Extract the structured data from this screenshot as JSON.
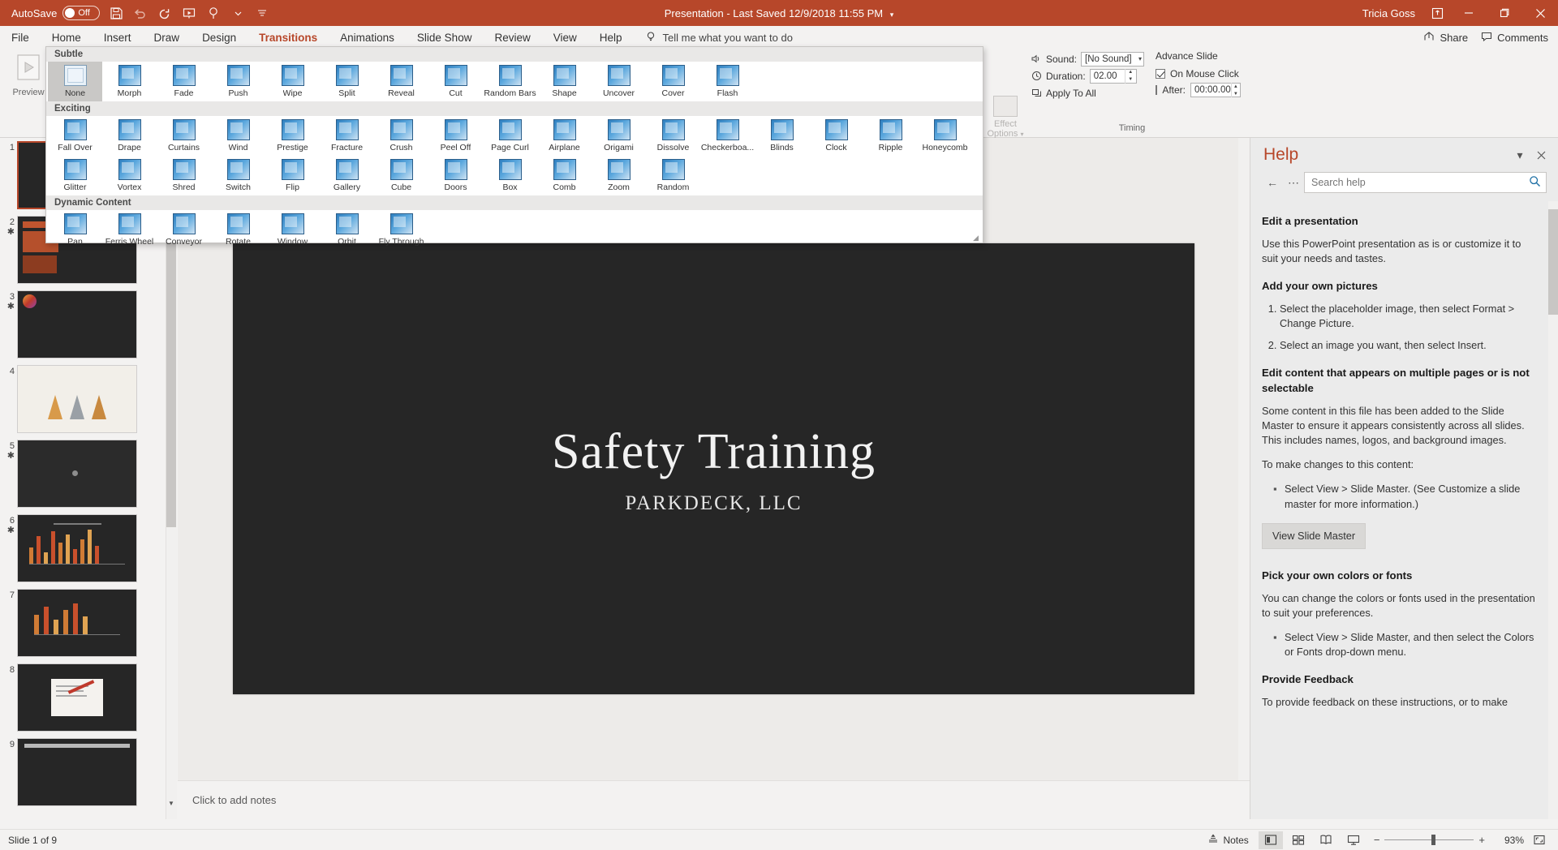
{
  "titlebar": {
    "autosave_label": "AutoSave",
    "autosave_state": "Off",
    "doc_title": "Presentation  -  Last Saved 12/9/2018 11:55 PM",
    "user": "Tricia Goss",
    "qat": [
      {
        "name": "save-icon",
        "label": "Save"
      },
      {
        "name": "undo-icon",
        "label": "Undo"
      },
      {
        "name": "redo-icon",
        "label": "Redo"
      },
      {
        "name": "start-from-beginning-icon",
        "label": "Start From Beginning"
      },
      {
        "name": "touch-mode-icon",
        "label": "Touch/Mouse Mode"
      },
      {
        "name": "customize-qat-icon",
        "label": "Customize Quick Access Toolbar"
      }
    ],
    "window_buttons": [
      "ribbon-display-options",
      "minimize",
      "restore",
      "close"
    ]
  },
  "tabs": [
    {
      "label": "File",
      "active": false
    },
    {
      "label": "Home",
      "active": false
    },
    {
      "label": "Insert",
      "active": false
    },
    {
      "label": "Draw",
      "active": false
    },
    {
      "label": "Design",
      "active": false
    },
    {
      "label": "Transitions",
      "active": true
    },
    {
      "label": "Animations",
      "active": false
    },
    {
      "label": "Slide Show",
      "active": false
    },
    {
      "label": "Review",
      "active": false
    },
    {
      "label": "View",
      "active": false
    },
    {
      "label": "Help",
      "active": false
    }
  ],
  "tellme": "Tell me what you want to do",
  "share_label": "Share",
  "comments_label": "Comments",
  "ribbon": {
    "preview_label": "Preview",
    "preview_group_label": "Preview",
    "effect_options_line1": "Effect",
    "effect_options_line2": "Options",
    "timing": {
      "group_label": "Timing",
      "sound_label": "Sound:",
      "sound_value": "[No Sound]",
      "duration_label": "Duration:",
      "duration_value": "02.00",
      "apply_to_all_label": "Apply To All",
      "advance_slide_label": "Advance Slide",
      "on_mouse_click_label": "On Mouse Click",
      "on_mouse_click_checked": true,
      "after_label": "After:",
      "after_value": "00:00.00",
      "after_checked": false
    }
  },
  "gallery": {
    "sections": [
      {
        "title": "Subtle",
        "items": [
          {
            "label": "None",
            "selected": true
          },
          {
            "label": "Morph",
            "selected": false
          },
          {
            "label": "Fade",
            "selected": false
          },
          {
            "label": "Push",
            "selected": false
          },
          {
            "label": "Wipe",
            "selected": false
          },
          {
            "label": "Split",
            "selected": false
          },
          {
            "label": "Reveal",
            "selected": false
          },
          {
            "label": "Cut",
            "selected": false
          },
          {
            "label": "Random Bars",
            "selected": false
          },
          {
            "label": "Shape",
            "selected": false
          },
          {
            "label": "Uncover",
            "selected": false
          },
          {
            "label": "Cover",
            "selected": false
          },
          {
            "label": "Flash",
            "selected": false
          }
        ]
      },
      {
        "title": "Exciting",
        "items": [
          {
            "label": "Fall Over",
            "selected": false
          },
          {
            "label": "Drape",
            "selected": false
          },
          {
            "label": "Curtains",
            "selected": false
          },
          {
            "label": "Wind",
            "selected": false
          },
          {
            "label": "Prestige",
            "selected": false
          },
          {
            "label": "Fracture",
            "selected": false
          },
          {
            "label": "Crush",
            "selected": false
          },
          {
            "label": "Peel Off",
            "selected": false
          },
          {
            "label": "Page Curl",
            "selected": false
          },
          {
            "label": "Airplane",
            "selected": false
          },
          {
            "label": "Origami",
            "selected": false
          },
          {
            "label": "Dissolve",
            "selected": false
          },
          {
            "label": "Checkerboa...",
            "selected": false
          },
          {
            "label": "Blinds",
            "selected": false
          },
          {
            "label": "Clock",
            "selected": false
          },
          {
            "label": "Ripple",
            "selected": false
          },
          {
            "label": "Honeycomb",
            "selected": false
          },
          {
            "label": "Glitter",
            "selected": false
          },
          {
            "label": "Vortex",
            "selected": false
          },
          {
            "label": "Shred",
            "selected": false
          },
          {
            "label": "Switch",
            "selected": false
          },
          {
            "label": "Flip",
            "selected": false
          },
          {
            "label": "Gallery",
            "selected": false
          },
          {
            "label": "Cube",
            "selected": false
          },
          {
            "label": "Doors",
            "selected": false
          },
          {
            "label": "Box",
            "selected": false
          },
          {
            "label": "Comb",
            "selected": false
          },
          {
            "label": "Zoom",
            "selected": false
          },
          {
            "label": "Random",
            "selected": false
          }
        ]
      },
      {
        "title": "Dynamic Content",
        "items": [
          {
            "label": "Pan",
            "selected": false
          },
          {
            "label": "Ferris Wheel",
            "selected": false
          },
          {
            "label": "Conveyor",
            "selected": false
          },
          {
            "label": "Rotate",
            "selected": false
          },
          {
            "label": "Window",
            "selected": false
          },
          {
            "label": "Orbit",
            "selected": false
          },
          {
            "label": "Fly Through",
            "selected": false
          }
        ]
      }
    ]
  },
  "thumbnails": [
    {
      "number": "1",
      "modified": false,
      "active": true,
      "kind": "title"
    },
    {
      "number": "2",
      "modified": true,
      "active": false,
      "kind": "text-orange"
    },
    {
      "number": "3",
      "modified": true,
      "active": false,
      "kind": "dark-swatch"
    },
    {
      "number": "4",
      "modified": false,
      "active": false,
      "kind": "cones"
    },
    {
      "number": "5",
      "modified": true,
      "active": false,
      "kind": "dark-dot"
    },
    {
      "number": "6",
      "modified": true,
      "active": false,
      "kind": "chart"
    },
    {
      "number": "7",
      "modified": false,
      "active": false,
      "kind": "chart2"
    },
    {
      "number": "8",
      "modified": false,
      "active": false,
      "kind": "doc-arrow"
    },
    {
      "number": "9",
      "modified": false,
      "active": false,
      "kind": "notice"
    }
  ],
  "slide": {
    "title": "Safety Training",
    "subtitle": "PARKDECK, LLC"
  },
  "notes_placeholder": "Click to add notes",
  "help": {
    "title": "Help",
    "search_placeholder": "Search help",
    "search_value": "",
    "sections": [
      {
        "heading": "Edit a presentation",
        "paragraphs": [
          "Use this PowerPoint presentation as is or customize it to suit your needs and tastes."
        ]
      },
      {
        "heading": "Add your own pictures",
        "ordered": [
          "Select the placeholder image, then select Format > Change Picture.",
          "Select an image you want, then select Insert."
        ]
      },
      {
        "heading": "Edit content that appears on multiple pages or is not selectable",
        "paragraphs": [
          "Some content in this file has been added to the Slide Master to ensure it appears consistently across all slides. This includes names, logos, and background images.",
          "To make changes to this content:"
        ],
        "bullets": [
          "Select View > Slide Master. (See Customize a slide master for more information.)"
        ],
        "link_text": "Customize a slide master",
        "button": "View Slide Master"
      },
      {
        "heading": "Pick your own colors or fonts",
        "paragraphs": [
          "You can change the colors or fonts used in the presentation to suit your preferences."
        ],
        "bullets": [
          "Select View > Slide Master, and then select the Colors or Fonts drop-down menu."
        ]
      },
      {
        "heading": "Provide Feedback",
        "paragraphs": [
          "To provide feedback on these instructions, or to make"
        ]
      }
    ]
  },
  "statusbar": {
    "slide_count": "Slide 1 of 9",
    "notes_label": "Notes",
    "zoom_percent": "93%",
    "views": [
      {
        "name": "normal-view-button",
        "active": true
      },
      {
        "name": "slide-sorter-view-button",
        "active": false
      },
      {
        "name": "reading-view-button",
        "active": false
      },
      {
        "name": "slide-show-button",
        "active": false
      }
    ],
    "zoom_minus": "−",
    "zoom_plus": "+"
  }
}
